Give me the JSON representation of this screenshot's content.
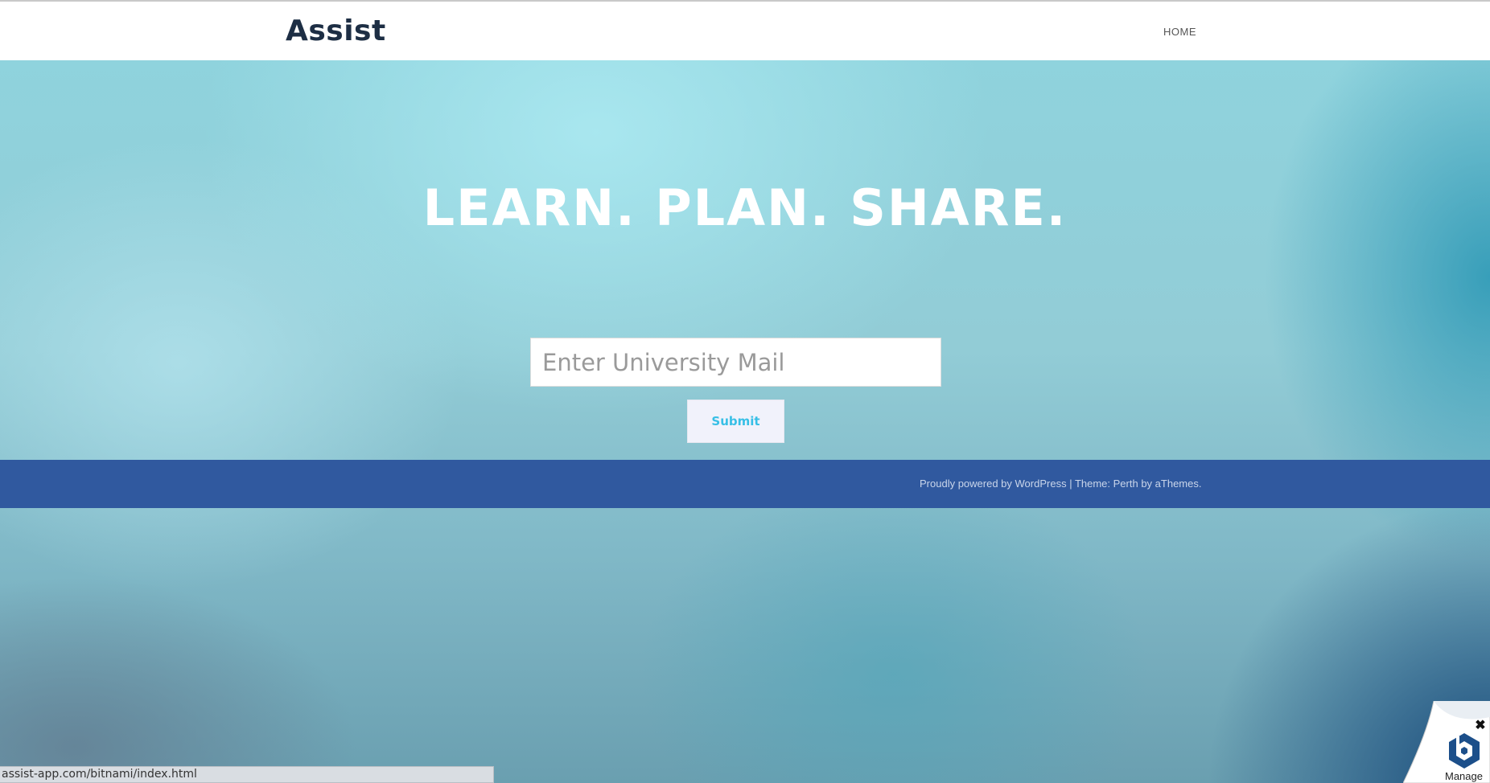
{
  "header": {
    "site_title": "Assist",
    "nav": [
      {
        "label": "HOME"
      }
    ]
  },
  "hero": {
    "headline": "LEARN. PLAN. SHARE.",
    "email_placeholder": "Enter University Mail",
    "submit_label": "Submit"
  },
  "footer": {
    "powered_prefix": "Proudly powered by WordPress",
    "separator": " | ",
    "theme_text": "Theme: Perth by aThemes."
  },
  "status_bar": {
    "url": "assist-app.com/bitnami/index.html"
  },
  "manage_widget": {
    "label": "Manage",
    "icon": "bitnami-logo-icon",
    "close_icon": "close-icon"
  },
  "colors": {
    "title": "#1d2e44",
    "footer_bg": "#30599f",
    "submit_text": "#37bfe6"
  }
}
